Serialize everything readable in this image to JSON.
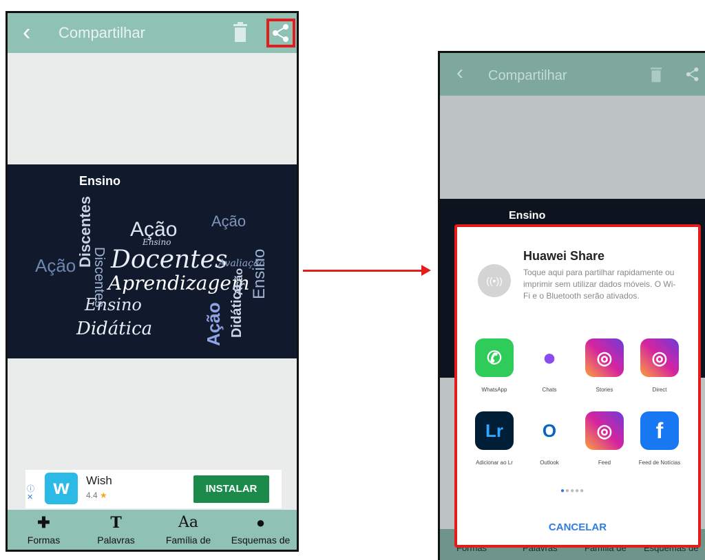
{
  "left_screen": {
    "header": {
      "title": "Compartilhar",
      "back_icon": "back-chevron-icon",
      "trash_icon": "trash-icon",
      "share_icon": "share-icon"
    },
    "word_cloud": {
      "words": [
        "Ensino",
        "Discentes",
        "Ação",
        "Docentes",
        "Aprendizagem",
        "Ensino",
        "Didática",
        "Ação",
        "Didática",
        "Ação",
        "Ensino",
        "Ação",
        "Ação",
        "Avaliação",
        "Ensino",
        "Discentes"
      ]
    },
    "ad": {
      "app_name": "Wish",
      "rating": "4.4",
      "install_label": "INSTALAR",
      "logo_letter": "w"
    },
    "toolbar": {
      "items": [
        {
          "label": "Formas",
          "icon": "puzzle-icon"
        },
        {
          "label": "Palavras",
          "icon": "text-t-icon"
        },
        {
          "label": "Família de",
          "icon": "font-aa-icon"
        },
        {
          "label": "Esquemas de",
          "icon": "palette-icon"
        }
      ]
    }
  },
  "right_screen": {
    "header": {
      "title": "Compartilhar"
    },
    "cloud_word": "Ensino",
    "bottom_labels": [
      "Formas",
      "Palavras",
      "Família de",
      "Esquemas de"
    ],
    "share_sheet": {
      "huawei_title": "Huawei Share",
      "huawei_desc": "Toque aqui para partilhar rapidamente ou imprimir sem utilizar dados móveis. O Wi-Fi e o Bluetooth serão ativados.",
      "apps": [
        {
          "label": "WhatsApp",
          "icon": "whatsapp-icon",
          "color": "#2fcc59"
        },
        {
          "label": "Chats",
          "icon": "messenger-icon",
          "color": "#8a4cf0"
        },
        {
          "label": "Stories",
          "icon": "instagram-icon",
          "color": "#d6249f"
        },
        {
          "label": "Direct",
          "icon": "instagram-icon",
          "color": "#d6249f"
        },
        {
          "label": "Adicionar ao Lr",
          "icon": "lightroom-icon",
          "color": "#001e36"
        },
        {
          "label": "Outlook",
          "icon": "outlook-icon",
          "color": "#0a64c8"
        },
        {
          "label": "Feed",
          "icon": "instagram-icon",
          "color": "#d6249f"
        },
        {
          "label": "Feed de Notícias",
          "icon": "facebook-icon",
          "color": "#1877f2"
        }
      ],
      "cancel_label": "CANCELAR"
    }
  },
  "colors": {
    "header": "#8fc1b4",
    "highlight": "#e31c1c",
    "install": "#1b8a4b",
    "cancel": "#2f7de1"
  }
}
